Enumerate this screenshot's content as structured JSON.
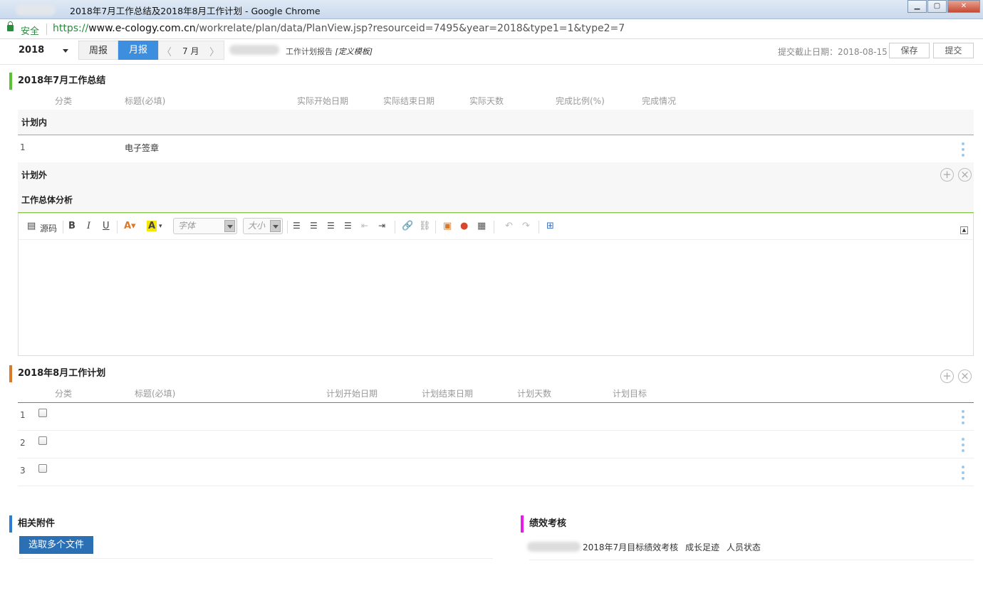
{
  "window": {
    "title": "2018年7月工作总结及2018年8月工作计划 - Google Chrome",
    "controls": [
      "minimize",
      "maximize",
      "close"
    ]
  },
  "address_bar": {
    "secure_label": "安全",
    "url_scheme": "https://",
    "url_host": "www.e-cology.com.cn",
    "url_path": "/workrelate/plan/data/PlanView.jsp?resourceid=7495&year=2018&type1=1&type2=7"
  },
  "toolbar": {
    "year": "2018",
    "week_label": "周报",
    "month_label": "月报",
    "month_value": "7 月",
    "report_title": "工作计划报告",
    "template_label": "[定义模板]",
    "deadline": "提交截止日期：2018-08-15",
    "save_label": "保存",
    "submit_label": "提交"
  },
  "summary": {
    "title": "2018年7月工作总结",
    "accent": "#5bc236",
    "columns": [
      "分类",
      "标题(必填)",
      "实际开始日期",
      "实际结束日期",
      "实际天数",
      "完成比例(%)",
      "完成情况"
    ],
    "in_plan_label": "计划内",
    "rows": [
      {
        "num": "1",
        "title": "电子签章"
      }
    ],
    "out_plan_label": "计划外",
    "analysis_label": "工作总体分析"
  },
  "editor": {
    "source_label": "源码",
    "bold": "B",
    "italic": "I",
    "underline": "U",
    "font_placeholder": "字体",
    "size_placeholder": "大小"
  },
  "plan": {
    "title": "2018年8月工作计划",
    "accent": "#d9792b",
    "columns": [
      "分类",
      "标题(必填)",
      "计划开始日期",
      "计划结束日期",
      "计划天数",
      "计划目标"
    ],
    "rows": [
      {
        "num": "1"
      },
      {
        "num": "2"
      },
      {
        "num": "3"
      }
    ]
  },
  "attachments": {
    "title": "相关附件",
    "accent": "#2f7bd1",
    "button_label": "选取多个文件"
  },
  "performance": {
    "title": "绩效考核",
    "accent": "#e81ce8",
    "links": [
      "2018年7月目标绩效考核",
      "成长足迹",
      "人员状态"
    ]
  }
}
